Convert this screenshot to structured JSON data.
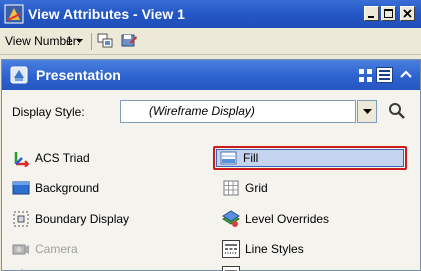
{
  "window": {
    "title": "View Attributes - View 1"
  },
  "toolbar": {
    "view_number_label": "View Number:",
    "view_number_value": "1"
  },
  "panel": {
    "title": "Presentation",
    "display_style_label": "Display Style:",
    "display_style_value": "(Wireframe Display)"
  },
  "items": {
    "acs_triad": "ACS Triad",
    "fill": "Fill",
    "background": "Background",
    "grid": "Grid",
    "boundary_display": "Boundary Display",
    "level_overrides": "Level Overrides",
    "camera": "Camera",
    "line_styles": "Line Styles"
  },
  "colors": {
    "titlebar": "#2458c7",
    "panel_header": "#2d63cf",
    "highlight_border": "#cc1b1b",
    "selected_fill": "#c4d4ee"
  },
  "icons": [
    "app-icon",
    "minimize-icon",
    "maximize-icon",
    "close-icon",
    "chevron-down-icon",
    "view-group-icon",
    "save-view-icon",
    "presentation-icon",
    "grid-view-icon",
    "list-view-icon",
    "collapse-icon",
    "search-icon",
    "acs-triad-icon",
    "fill-icon",
    "background-icon",
    "grid-icon",
    "boundary-display-icon",
    "level-overrides-icon",
    "camera-icon",
    "line-styles-icon"
  ]
}
